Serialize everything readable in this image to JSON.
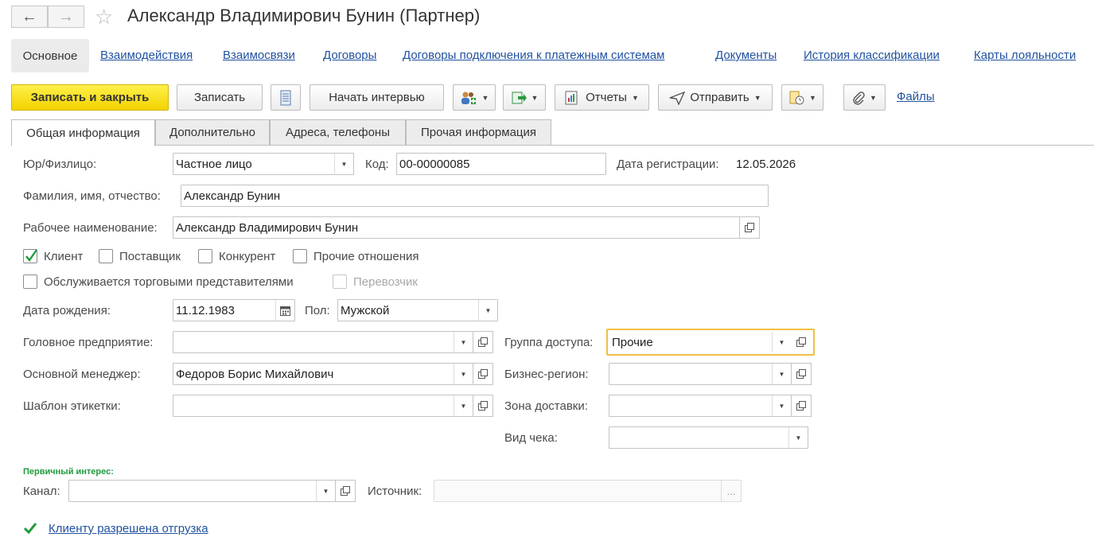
{
  "window": {
    "title": "Александр Владимирович Бунин (Партнер)",
    "back_icon": "arrow-left-icon",
    "forward_icon": "arrow-right-icon",
    "favorite_icon": "star-icon"
  },
  "sections": {
    "active": "Основное",
    "links": [
      "Взаимодействия",
      "Взаимосвязи",
      "Договоры",
      "Договоры подключения к платежным системам",
      "Документы",
      "История классификации",
      "Карты лояльности"
    ]
  },
  "toolbar": {
    "save_close": "Записать и закрыть",
    "save": "Записать",
    "start_interview": "Начать интервью",
    "reports": "Отчеты",
    "send": "Отправить",
    "files": "Файлы"
  },
  "tabs": [
    "Общая информация",
    "Дополнительно",
    "Адреса, телефоны",
    "Прочая информация"
  ],
  "form": {
    "legal_type_label": "Юр/Физлицо:",
    "legal_type_value": "Частное лицо",
    "code_label": "Код:",
    "code_value": "00-00000085",
    "reg_date_label": "Дата регистрации:",
    "reg_date_value": "12.05.2026",
    "fio_label": "Фамилия, имя, отчество:",
    "fio_value": "Александр Бунин",
    "work_name_label": "Рабочее наименование:",
    "work_name_value": "Александр Владимирович Бунин",
    "relations": [
      {
        "label": "Клиент",
        "checked": true
      },
      {
        "label": "Поставщик",
        "checked": false
      },
      {
        "label": "Конкурент",
        "checked": false
      },
      {
        "label": "Прочие отношения",
        "checked": false
      }
    ],
    "served_by_reps_label": "Обслуживается торговыми представителями",
    "carrier_label": "Перевозчик",
    "birth_date_label": "Дата рождения:",
    "birth_date_value": "11.12.1983",
    "gender_label": "Пол:",
    "gender_value": "Мужской",
    "head_company_label": "Головное предприятие:",
    "head_company_value": "",
    "manager_label": "Основной менеджер:",
    "manager_value": "Федоров Борис Михайлович",
    "label_template_label": "Шаблон этикетки:",
    "label_template_value": "",
    "access_group_label": "Группа доступа:",
    "access_group_value": "Прочие",
    "business_region_label": "Бизнес-регион:",
    "business_region_value": "",
    "delivery_zone_label": "Зона доставки:",
    "delivery_zone_value": "",
    "receipt_type_label": "Вид чека:",
    "receipt_type_value": "",
    "primary_interest_header": "Первичный интерес:",
    "channel_label": "Канал:",
    "channel_value": "",
    "source_label": "Источник:",
    "source_value": "",
    "shipment_allowed": "Клиенту разрешена отгрузка"
  },
  "colors": {
    "primary_button": "#f2d200",
    "link": "#2152a0",
    "green_check": "#1f9b3e",
    "focus_border": "#f0c040"
  }
}
